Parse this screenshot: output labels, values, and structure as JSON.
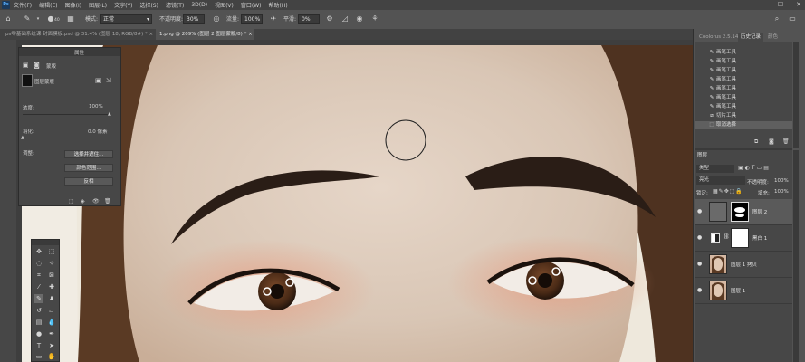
{
  "menubar": {
    "logo": "Ps",
    "items": [
      "文件(F)",
      "编辑(E)",
      "图像(I)",
      "图层(L)",
      "文字(Y)",
      "选择(S)",
      "滤镜(T)",
      "3D(D)",
      "视图(V)",
      "窗口(W)",
      "帮助(H)"
    ],
    "window_controls": [
      "—",
      "☐",
      "✕"
    ]
  },
  "options": {
    "mode_label": "模式:",
    "mode_value": "正常",
    "opacity_label": "不透明度:",
    "opacity_value": "30%",
    "flow_label": "流量:",
    "flow_value": "100%",
    "smooth_label": "平滑:",
    "smooth_value": "0%",
    "brush_size": "40"
  },
  "tabs": [
    {
      "label": "ps零基础系统课 封面模板.psd @ 31.4% (图层 18, RGB/8#) *",
      "close": "×"
    },
    {
      "label": "1.png @ 209% (图层 2 图层蒙版/8) *",
      "close": "×"
    }
  ],
  "properties": {
    "tabs": [
      "属性"
    ],
    "section_title": "蒙版",
    "mask_label": "图层蒙版",
    "density_label": "浓度:",
    "density_value": "100%",
    "feather_label": "羽化:",
    "feather_value": "0.0 像素",
    "adjust_label": "调整:",
    "buttons": [
      "选择并遮住...",
      "颜色范围...",
      "反相"
    ]
  },
  "dock": {
    "tabs": [
      "Coolorus 2.5.14",
      "历史记录",
      "颜色"
    ],
    "history": [
      "画笔工具",
      "画笔工具",
      "画笔工具",
      "画笔工具",
      "画笔工具",
      "画笔工具",
      "画笔工具",
      "切片工具",
      "取消选择"
    ]
  },
  "layers_panel": {
    "tab": "图层",
    "filter_label": "类型",
    "blend_mode": "亮光",
    "opacity_label": "不透明度:",
    "opacity_value": "100%",
    "lock_label": "锁定:",
    "fill_label": "填充:",
    "fill_value": "100%",
    "layers": [
      {
        "name": "图层 2"
      },
      {
        "name": "黑白 1"
      },
      {
        "name": "图层 1 拷贝"
      },
      {
        "name": "图层 1"
      }
    ]
  },
  "colors": {
    "menubar_bg": "#434343",
    "panel_bg": "#474747",
    "workspace_bg": "#535353",
    "accent_blue": "#59b0ff"
  }
}
